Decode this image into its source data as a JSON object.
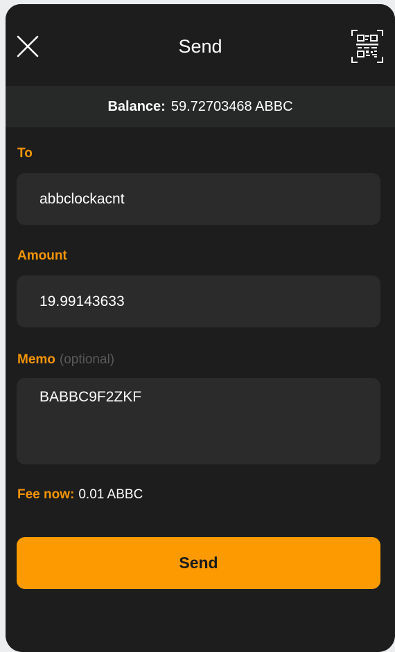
{
  "header": {
    "title": "Send",
    "close_icon": "close-icon",
    "scan_icon": "qr-scan-icon"
  },
  "balance": {
    "label": "Balance:",
    "value": "59.72703468 ABBC"
  },
  "form": {
    "to": {
      "label": "To",
      "value": "abbclockacnt"
    },
    "amount": {
      "label": "Amount",
      "value": "19.99143633"
    },
    "memo": {
      "label": "Memo",
      "hint": "(optional)",
      "value": "BABBC9F2ZKF"
    }
  },
  "fee": {
    "label": "Fee now:",
    "value": "0.01 ABBC"
  },
  "actions": {
    "send_label": "Send"
  },
  "colors": {
    "accent": "#f39508",
    "button": "#fe9a01",
    "background": "#1d1d1d",
    "input_background": "#2b2b2b"
  }
}
